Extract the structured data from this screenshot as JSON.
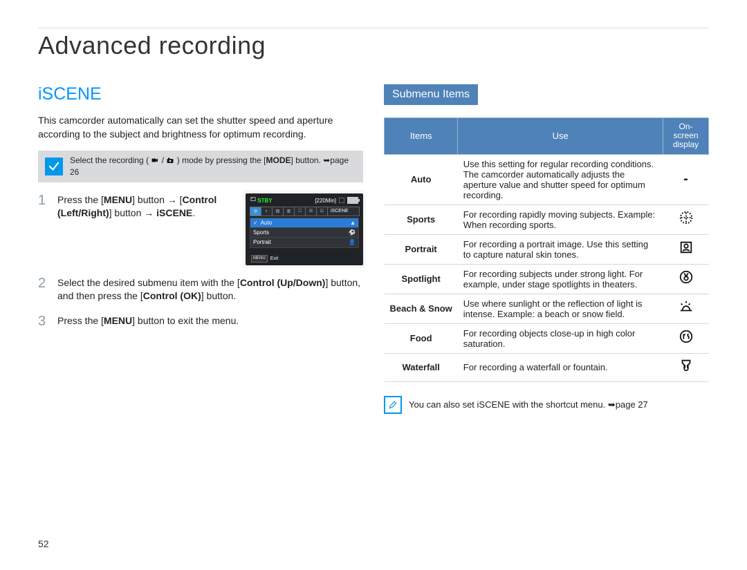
{
  "chapter_title": "Advanced recording",
  "page_number": "52",
  "left": {
    "heading": "iSCENE",
    "intro": "This camcorder automatically can set the shutter speed and aperture according to the subject and brightness for optimum recording.",
    "note_pre": "Select the recording (",
    "note_post": ") mode by pressing the ",
    "note_button": "MODE",
    "note_end": " button. ",
    "note_ref": "page 26",
    "steps": {
      "s1_a": "Press the [",
      "s1_menu": "MENU",
      "s1_b": "] button → [",
      "s1_ctrl": "Control (Left/Right)",
      "s1_c": "] button → ",
      "s1_iscene": "iSCENE",
      "s1_d": ".",
      "s2_a": "Select the desired submenu item with the [",
      "s2_ctrl1": "Control (Up/Down)",
      "s2_b": "] button, and then press the [",
      "s2_ctrl2": "Control (OK)",
      "s2_c": "] button.",
      "s3_a": "Press the [",
      "s3_menu": "MENU",
      "s3_b": "] button to exit the menu."
    },
    "lcd": {
      "stby": "STBY",
      "time": "[220Min]",
      "tab_label": "iSCENE",
      "rows": [
        "Auto",
        "Sports",
        "Portrait"
      ],
      "footer_btn": "MENU",
      "footer_text": "Exit"
    }
  },
  "right": {
    "subhead": "Submenu Items",
    "th_items": "Items",
    "th_use": "Use",
    "th_osd_l1": "On-screen",
    "th_osd_l2": "display",
    "rows": [
      {
        "name": "Auto",
        "use": "Use this setting for regular recording conditions. The camcorder automatically adjusts the aperture value and shutter speed for optimum recording.",
        "osd": "-",
        "icon": "none"
      },
      {
        "name": "Sports",
        "use": "For recording rapidly moving subjects. Example: When recording sports.",
        "osd": "",
        "icon": "sports"
      },
      {
        "name": "Portrait",
        "use": "For recording a portrait image. Use this setting to capture natural skin tones.",
        "osd": "",
        "icon": "portrait"
      },
      {
        "name": "Spotlight",
        "use": "For recording subjects under strong light. For example, under stage spotlights in theaters.",
        "osd": "",
        "icon": "spotlight"
      },
      {
        "name": "Beach & Snow",
        "use": "Use where sunlight or the reflection of light is intense. Example: a beach or snow field.",
        "osd": "",
        "icon": "beach"
      },
      {
        "name": "Food",
        "use": "For recording objects close-up in high color saturation.",
        "osd": "",
        "icon": "food"
      },
      {
        "name": "Waterfall",
        "use": "For recording a waterfall or fountain.",
        "osd": "",
        "icon": "waterfall"
      }
    ],
    "tip_text": "You can also set iSCENE with the shortcut menu. ",
    "tip_ref": "page 27"
  }
}
